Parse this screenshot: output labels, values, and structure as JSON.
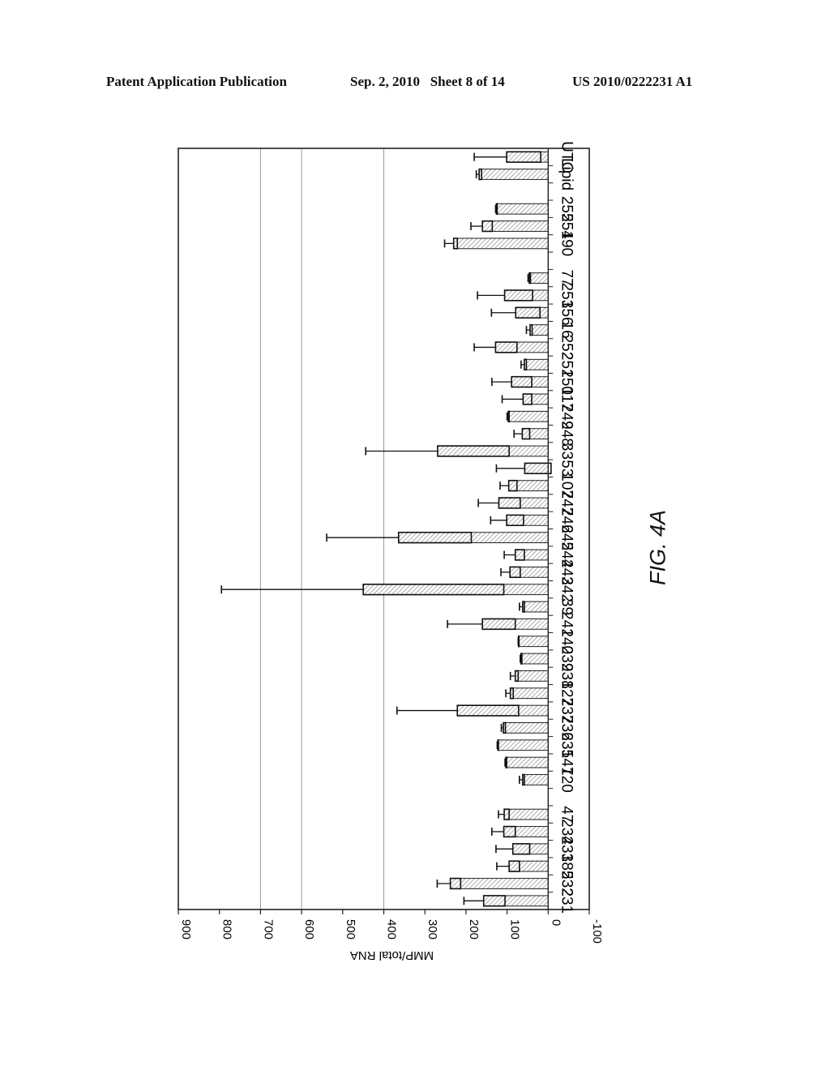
{
  "header": {
    "left": "Patent Application Publication",
    "middle": "Sep. 2, 2010   Sheet 8 of 14",
    "right": "US 2010/0222231 A1"
  },
  "figure_label": "FIG. 4A",
  "chart_data": {
    "type": "bar",
    "orientation": "rotated-90",
    "title": "",
    "xlabel": "",
    "ylabel": "MMP/total RNA",
    "ylim": [
      -100,
      900
    ],
    "yticks": [
      900,
      800,
      700,
      600,
      500,
      400,
      300,
      200,
      100,
      0,
      -100
    ],
    "gridlines_at": [
      700,
      600,
      400
    ],
    "categories": [
      "231",
      "232",
      "185",
      "233",
      "234",
      "47",
      "",
      "120",
      "147",
      "235",
      "236",
      "237",
      "127",
      "238",
      "239",
      "240",
      "241",
      "39",
      "242",
      "243",
      "244",
      "245",
      "246",
      "247",
      "107",
      "53",
      "33",
      "248",
      "249",
      "117",
      "250",
      "251",
      "252",
      "16",
      "156",
      "253",
      "77",
      "",
      "190",
      "254",
      "255",
      "",
      "Lipid",
      "UTC"
    ],
    "series": [
      {
        "name": "MMP/total RNA",
        "values": [
          157,
          238,
          95,
          86,
          108,
          107,
          null,
          62,
          103,
          122,
          109,
          221,
          92,
          80,
          66,
          72,
          160,
          62,
          450,
          93,
          80,
          364,
          101,
          120,
          96,
          57,
          269,
          63,
          97,
          61,
          89,
          58,
          128,
          44,
          79,
          106,
          46,
          null,
          230,
          160,
          126,
          null,
          168,
          101
        ],
        "inner_values": [
          105,
          213,
          70,
          45,
          80,
          95,
          null,
          58,
          101,
          121,
          104,
          72,
          85,
          73,
          64,
          71,
          80,
          58,
          108,
          68,
          58,
          187,
          60,
          68,
          76,
          -7,
          95,
          45,
          95,
          40,
          40,
          53,
          76,
          39,
          20,
          38,
          43,
          null,
          221,
          136,
          124,
          null,
          162,
          18
        ],
        "error_upper": [
          205,
          270,
          125,
          127,
          137,
          121,
          null,
          70,
          105,
          124,
          114,
          368,
          103,
          92,
          68,
          73,
          245,
          70,
          795,
          115,
          107,
          539,
          140,
          170,
          117,
          126,
          444,
          83,
          100,
          112,
          137,
          66,
          180,
          53,
          138,
          172,
          49,
          null,
          252,
          188,
          128,
          null,
          175,
          180
        ]
      }
    ]
  }
}
